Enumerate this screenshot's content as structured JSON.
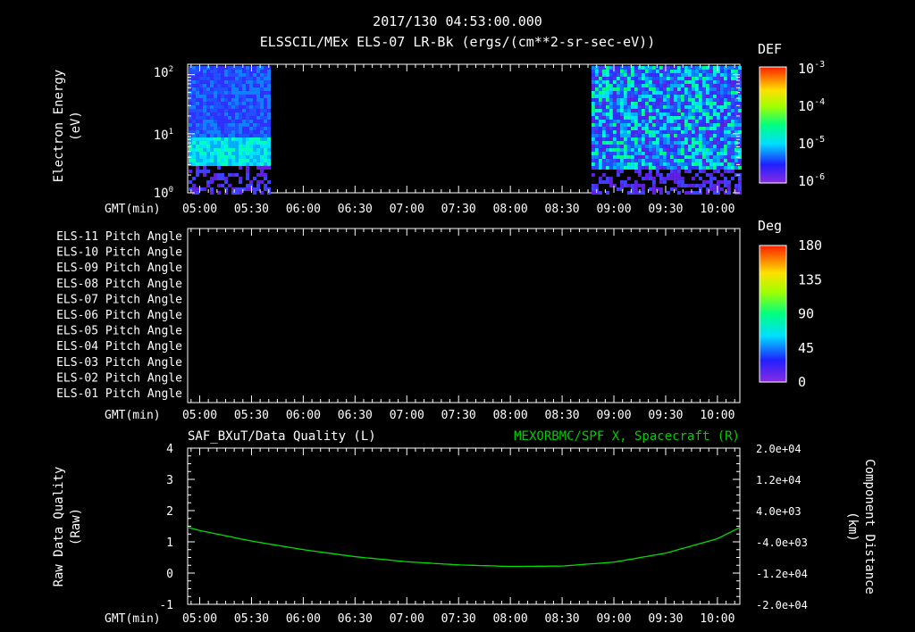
{
  "title": "2017/130 04:53:00.000",
  "subtitle": "ELSSCIL/MEx ELS-07 LR-Bk  (ergs/(cm**2-sr-sec-eV))",
  "time_ticks": [
    "05:00",
    "05:30",
    "06:00",
    "06:30",
    "07:00",
    "07:30",
    "08:00",
    "08:30",
    "09:00",
    "09:30",
    "10:00"
  ],
  "gmt_label": "GMT(min)",
  "colors": {
    "text": "#ffffff",
    "background": "#000000",
    "line": "#00dd00",
    "right_title": "#00cc00"
  },
  "chart_data": [
    {
      "type": "heatmap",
      "ylabel_line1": "Electron Energy",
      "ylabel_line2": "(eV)",
      "yscale": "log",
      "ylim": [
        1,
        150
      ],
      "ytick_labels": [
        {
          "base": "10",
          "exp": "0"
        },
        {
          "base": "10",
          "exp": "1"
        },
        {
          "base": "10",
          "exp": "2"
        }
      ],
      "xlim": [
        "04:53",
        "10:13"
      ],
      "data_blocks": [
        {
          "start": "04:53",
          "end": "05:41"
        },
        {
          "start": "08:47",
          "end": "10:13"
        }
      ],
      "colorbar": {
        "label": "DEF",
        "scale": "log",
        "tick_labels": [
          {
            "base": "10",
            "exp": "-3"
          },
          {
            "base": "10",
            "exp": "-4"
          },
          {
            "base": "10",
            "exp": "-5"
          },
          {
            "base": "10",
            "exp": "-6"
          }
        ]
      }
    },
    {
      "type": "heatmap",
      "row_labels": [
        "ELS-11 Pitch Angle",
        "ELS-10 Pitch Angle",
        "ELS-09 Pitch Angle",
        "ELS-08 Pitch Angle",
        "ELS-07 Pitch Angle",
        "ELS-06 Pitch Angle",
        "ELS-05 Pitch Angle",
        "ELS-04 Pitch Angle",
        "ELS-03 Pitch Angle",
        "ELS-02 Pitch Angle",
        "ELS-01 Pitch Angle"
      ],
      "colorbar": {
        "label": "Deg",
        "ticks": [
          180,
          135,
          90,
          45,
          0
        ]
      },
      "values": []
    },
    {
      "type": "line",
      "left_title": "SAF_BXuT/Data Quality (L)",
      "right_title": "MEXORBMC/SPF X, Spacecraft (R)",
      "ylabel_left_line1": "Raw Data Quality",
      "ylabel_left_line2": "(Raw)",
      "ylabel_right_line1": "Component Distance",
      "ylabel_right_line2": "(km)",
      "ylim_left": [
        -1,
        4
      ],
      "yticks_left": [
        4,
        3,
        2,
        1,
        0,
        -1
      ],
      "ylim_right": [
        -20000,
        20000
      ],
      "yticks_right": [
        "2.0e+04",
        "1.2e+04",
        "4.0e+03",
        "-4.0e+03",
        "-1.2e+04",
        "-2.0e+04"
      ],
      "series": [
        {
          "name": "MEXORBMC/SPF X, Spacecraft (R)",
          "x": [
            "04:53",
            "05:00",
            "05:30",
            "06:00",
            "06:30",
            "07:00",
            "07:30",
            "08:00",
            "08:30",
            "09:00",
            "09:30",
            "10:00",
            "10:13"
          ],
          "y": [
            -300,
            -1100,
            -3800,
            -6000,
            -7800,
            -9100,
            -9900,
            -10300,
            -10200,
            -9200,
            -6900,
            -3200,
            -300
          ]
        }
      ]
    }
  ]
}
